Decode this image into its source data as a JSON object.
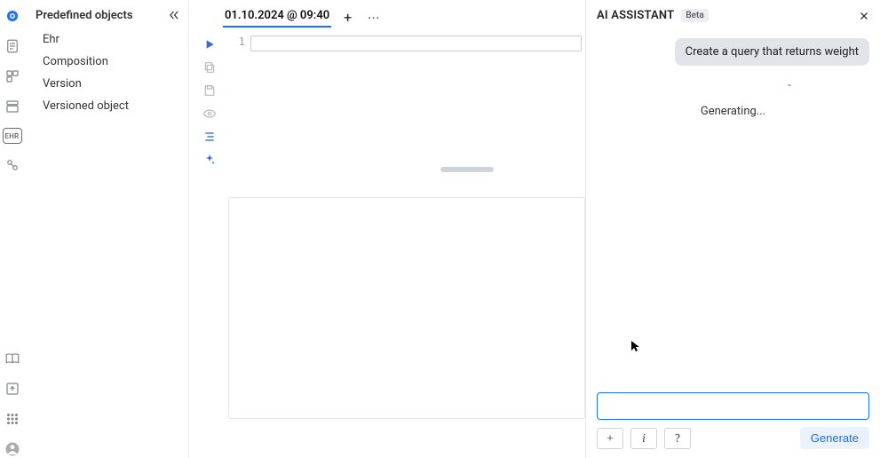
{
  "sidebar": {
    "title": "Predefined objects",
    "items": [
      {
        "label": "Ehr"
      },
      {
        "label": "Composition"
      },
      {
        "label": "Version"
      },
      {
        "label": "Versioned object"
      }
    ]
  },
  "rail": {
    "icons": [
      {
        "name": "logo-icon"
      },
      {
        "name": "doc-icon"
      },
      {
        "name": "schema-icon"
      },
      {
        "name": "folder-icon"
      },
      {
        "name": "ehr-icon",
        "text": "EHR",
        "active": true
      },
      {
        "name": "query-icon"
      }
    ],
    "bottom_icons": [
      {
        "name": "book-icon"
      },
      {
        "name": "upload-icon"
      },
      {
        "name": "apps-icon"
      },
      {
        "name": "user-icon"
      }
    ]
  },
  "tabs": {
    "active_label": "01.10.2024 @ 09:40"
  },
  "editor": {
    "line_numbers": [
      "1"
    ]
  },
  "assistant": {
    "title": "AI ASSISTANT",
    "badge": "Beta",
    "user_message": "Create a query that returns weight",
    "typing_indicator": "-",
    "status": "Generating...",
    "input_value": "",
    "buttons": {
      "add": "+",
      "info": "i",
      "help": "?",
      "generate": "Generate"
    }
  }
}
